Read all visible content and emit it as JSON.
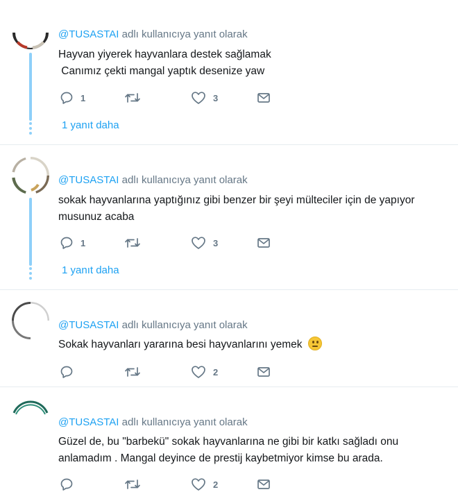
{
  "replies": [
    {
      "handle": "@TUSASTAI",
      "context_suffix": "adlı kullanıcıya yanıt olarak",
      "text_lines": [
        "Hayvan yiyerek hayvanlara destek sağlamak",
        " Canımız çekti mangal yaptık desenize yaw"
      ],
      "reply_count": "1",
      "retweet_count": "",
      "like_count": "3",
      "more_replies": "1 yanıt daha"
    },
    {
      "handle": "@TUSASTAI",
      "context_suffix": "adlı kullanıcıya yanıt olarak",
      "text_lines": [
        "sokak hayvanlarına yaptığınız gibi benzer bir şeyi mülteciler için de yapıyor",
        "musunuz acaba"
      ],
      "reply_count": "1",
      "retweet_count": "",
      "like_count": "3",
      "more_replies": "1 yanıt daha"
    },
    {
      "handle": "@TUSASTAI",
      "context_suffix": "adlı kullanıcıya yanıt olarak",
      "text_lines": [
        "Sokak hayvanları yararına besi hayvanlarını yemek"
      ],
      "emoji": "neutral-face-emoji",
      "reply_count": "",
      "retweet_count": "",
      "like_count": "2"
    },
    {
      "handle": "@TUSASTAI",
      "context_suffix": "adlı kullanıcıya yanıt olarak",
      "text_lines": [
        "Güzel de, bu \"barbekü\" sokak hayvanlarına ne gibi bir katkı sağladı onu",
        "anlamadım . Mangal deyince de prestij kaybetmiyor kimse bu arada."
      ],
      "reply_count": "",
      "retweet_count": "",
      "like_count": "2"
    }
  ],
  "icons": {
    "reply": "reply-icon",
    "retweet": "retweet-icon",
    "like": "heart-icon",
    "message": "envelope-icon"
  },
  "colors": {
    "link": "#1da1f2",
    "thread_line": "#8ed0f9",
    "muted": "#657786",
    "text": "#14171a",
    "divider": "#e6ecf0"
  }
}
